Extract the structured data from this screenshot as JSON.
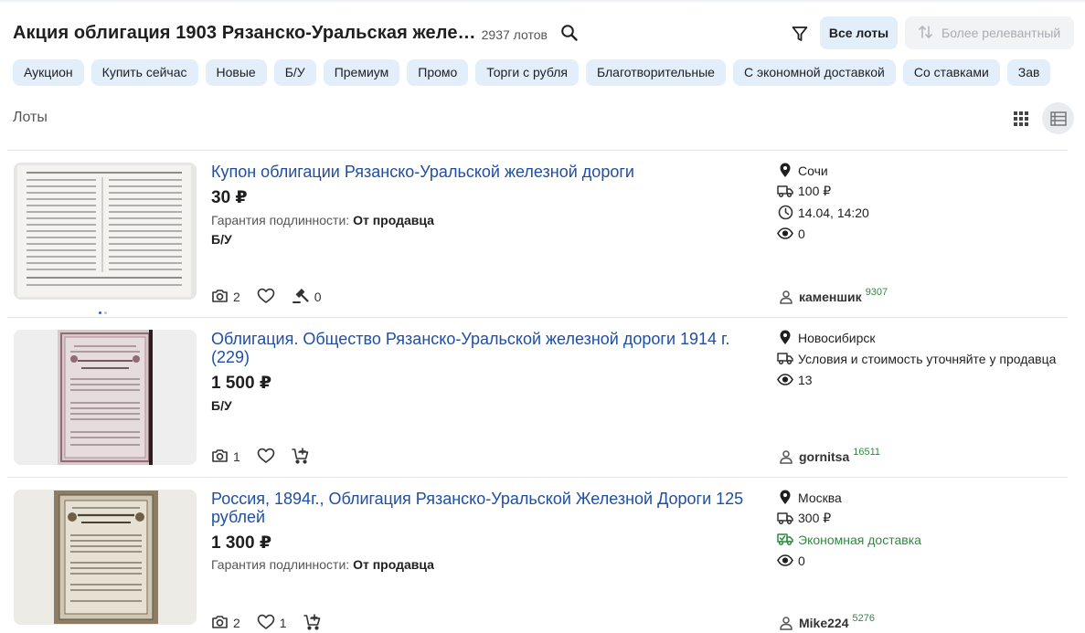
{
  "header": {
    "title": "Акция облигация 1903 Рязанско-Уральская желе…",
    "count": "2937 лотов",
    "all_lots": "Все лоты",
    "sort": "Более релевантный"
  },
  "chips": [
    "Аукцион",
    "Купить сейчас",
    "Новые",
    "Б/У",
    "Премиум",
    "Промо",
    "Торги с рубля",
    "Благотворительные",
    "С экономной доставкой",
    "Со ставками",
    "Зав"
  ],
  "section": {
    "title": "Лоты"
  },
  "lots": [
    {
      "title": "Купон облигации Рязанско-Уральской железной дороги",
      "price": "30 ₽",
      "guarantee_label": "Гарантия подлинности:",
      "guarantee_value": "От продавца",
      "condition": "Б/У",
      "photos": "2",
      "bids": "0",
      "city": "Сочи",
      "delivery": "100 ₽",
      "time": "14.04, 14:20",
      "views": "0",
      "seller": "каменшик",
      "rating": "9307"
    },
    {
      "title": "Облигация. Общество Рязанско-Уральской железной дороги 1914 г. (229)",
      "price": "1 500 ₽",
      "condition": "Б/У",
      "photos": "1",
      "city": "Новосибирск",
      "delivery": "Условия и стоимость уточняйте у продавца",
      "views": "13",
      "seller": "gornitsa",
      "rating": "16511"
    },
    {
      "title": "Россия, 1894г., Облигация Рязанско-Уральской Железной Дороги 125 рублей",
      "price": "1 300 ₽",
      "guarantee_label": "Гарантия подлинности:",
      "guarantee_value": "От продавца",
      "photos": "2",
      "likes": "1",
      "city": "Москва",
      "delivery": "300 ₽",
      "eco_delivery": "Экономная доставка",
      "views": "0",
      "seller": "Mike224",
      "rating": "5276"
    }
  ],
  "colors": {
    "accent_chip": "#e3eefb",
    "link": "#1f4fa5",
    "green": "#2e8b3e"
  }
}
